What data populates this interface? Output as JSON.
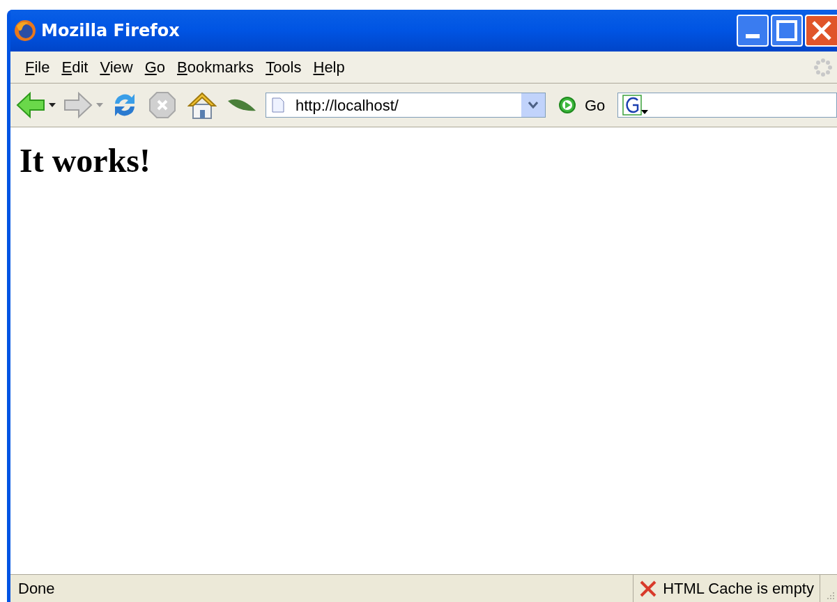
{
  "window": {
    "title": "Mozilla Firefox"
  },
  "menu": [
    "File",
    "Edit",
    "View",
    "Go",
    "Bookmarks",
    "Tools",
    "Help"
  ],
  "toolbar": {
    "url": "http://localhost/",
    "go_label": "Go"
  },
  "page": {
    "heading": "It works!"
  },
  "status_bar": {
    "text": "Done",
    "cache_status": "HTML Cache is empty"
  }
}
